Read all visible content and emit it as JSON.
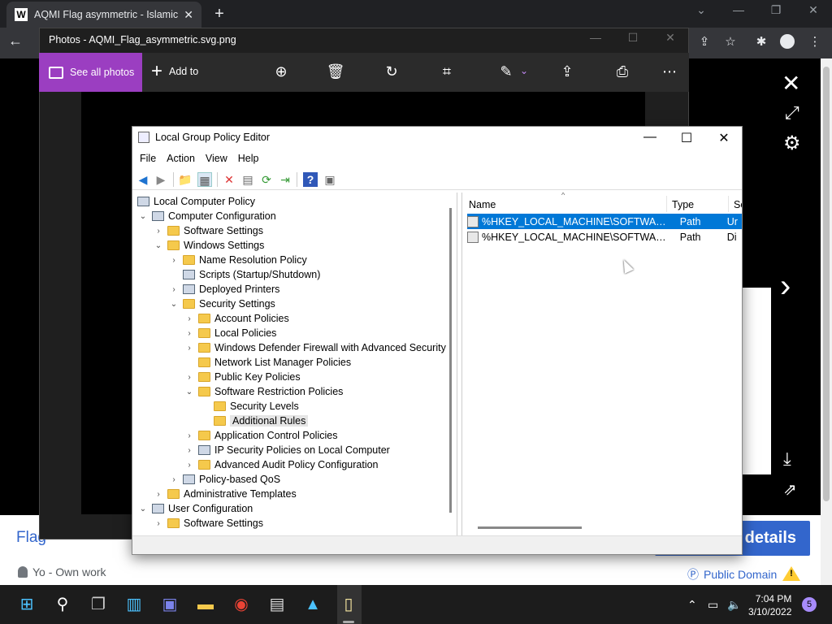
{
  "browser": {
    "tab_title": "AQMI Flag asymmetric - Islamic",
    "tab_favicon": "W",
    "new_tab_label": "+"
  },
  "photos": {
    "window_title": "Photos - AQMI_Flag_asymmetric.svg.png",
    "see_all_label": "See all photos",
    "add_to_label": "Add to"
  },
  "page": {
    "flag_text": "Flag",
    "details_label": "details",
    "credit": "Yo - Own work",
    "license": "Public Domain"
  },
  "gpedit": {
    "window_title": "Local Group Policy Editor",
    "menu": [
      "File",
      "Action",
      "View",
      "Help"
    ],
    "tree": [
      {
        "label": "Local Computer Policy"
      },
      {
        "label": "Computer Configuration"
      },
      {
        "label": "Software Settings"
      },
      {
        "label": "Windows Settings"
      },
      {
        "label": "Name Resolution Policy"
      },
      {
        "label": "Scripts (Startup/Shutdown)"
      },
      {
        "label": "Deployed Printers"
      },
      {
        "label": "Security Settings"
      },
      {
        "label": "Account Policies"
      },
      {
        "label": "Local Policies"
      },
      {
        "label": "Windows Defender Firewall with Advanced Security"
      },
      {
        "label": "Network List Manager Policies"
      },
      {
        "label": "Public Key Policies"
      },
      {
        "label": "Software Restriction Policies"
      },
      {
        "label": "Security Levels"
      },
      {
        "label": "Additional Rules"
      },
      {
        "label": "Application Control Policies"
      },
      {
        "label": "IP Security Policies on Local Computer"
      },
      {
        "label": "Advanced Audit Policy Configuration"
      },
      {
        "label": "Policy-based QoS"
      },
      {
        "label": "Administrative Templates"
      },
      {
        "label": "User Configuration"
      },
      {
        "label": "Software Settings"
      }
    ],
    "list_headers": {
      "name": "Name",
      "type": "Type",
      "security": "Se"
    },
    "rules": [
      {
        "name": "%HKEY_LOCAL_MACHINE\\SOFTWARE\\...",
        "type": "Path",
        "security": "Ur"
      },
      {
        "name": "%HKEY_LOCAL_MACHINE\\SOFTWARE\\...",
        "type": "Path",
        "security": "Di"
      }
    ]
  },
  "taskbar": {
    "time": "7:04 PM",
    "date": "3/10/2022",
    "notifications": "5"
  }
}
